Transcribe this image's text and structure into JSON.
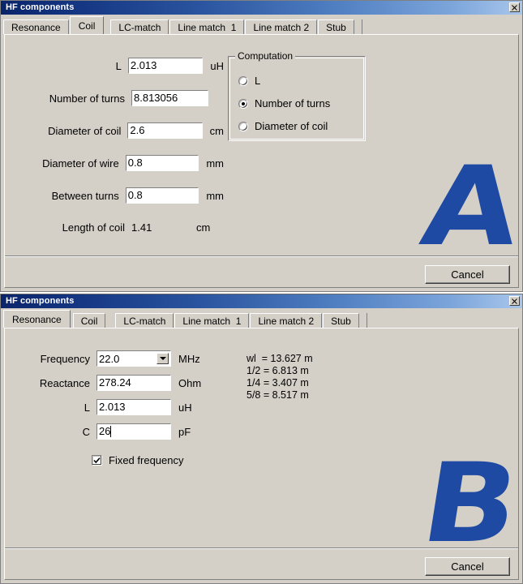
{
  "windows": [
    {
      "id": "A",
      "title": "HF components",
      "close_label": "×",
      "tabs": [
        {
          "label": "Resonance",
          "active": false
        },
        {
          "label": "Coil",
          "active": true
        },
        {
          "label": "LC-match",
          "active": false
        },
        {
          "label": "Line match  1",
          "active": false
        },
        {
          "label": "Line match 2",
          "active": false
        },
        {
          "label": "Stub",
          "active": false
        }
      ],
      "coil_form": {
        "rows": [
          {
            "label": "L",
            "value": "2.013",
            "unit": "uH"
          },
          {
            "label": "Number of turns",
            "value": "8.813056",
            "unit": ""
          },
          {
            "label": "Diameter of coil",
            "value": "2.6",
            "unit": "cm"
          },
          {
            "label": "Diameter of wire",
            "value": "0.8",
            "unit": "mm"
          },
          {
            "label": "Between turns",
            "value": "0.8",
            "unit": "mm"
          }
        ],
        "readonly_row": {
          "label": "Length of coil",
          "value": "1.41",
          "unit": "cm"
        }
      },
      "computation": {
        "title": "Computation",
        "options": [
          {
            "label": "L",
            "selected": false
          },
          {
            "label": "Number of turns",
            "selected": true
          },
          {
            "label": "Diameter of coil",
            "selected": false
          }
        ]
      },
      "cancel_label": "Cancel",
      "overlay_letter": "A"
    },
    {
      "id": "B",
      "title": "HF components",
      "close_label": "×",
      "tabs": [
        {
          "label": "Resonance",
          "active": true
        },
        {
          "label": "Coil",
          "active": false
        },
        {
          "label": "LC-match",
          "active": false
        },
        {
          "label": "Line match  1",
          "active": false
        },
        {
          "label": "Line match 2",
          "active": false
        },
        {
          "label": "Stub",
          "active": false
        }
      ],
      "resonance_form": {
        "frequency": {
          "label": "Frequency",
          "value": "22.0",
          "unit": "MHz"
        },
        "reactance": {
          "label": "Reactance",
          "value": "278.24",
          "unit": "Ohm"
        },
        "inductance": {
          "label": "L",
          "value": "2.013",
          "unit": "uH"
        },
        "capacitance": {
          "label": "C",
          "value": "26",
          "unit": "pF"
        },
        "fixed_frequency": {
          "label": "Fixed frequency",
          "checked": true
        }
      },
      "wavelength_info": "wl  = 13.627 m\n1/2 = 6.813 m\n1/4 = 3.407 m\n5/8 = 8.517 m",
      "cancel_label": "Cancel",
      "overlay_letter": "B"
    }
  ],
  "colors": {
    "face": "#d4d0c8",
    "title_dark": "#0a246a",
    "title_light": "#a8c6eb",
    "overlay_blue": "#1f4aa3",
    "field_bg": "#ffffff"
  }
}
